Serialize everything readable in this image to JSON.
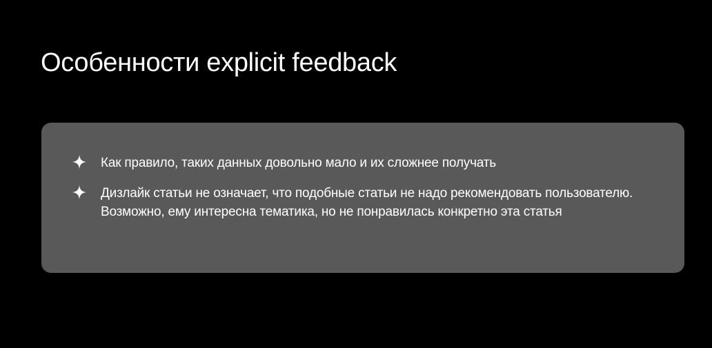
{
  "slide": {
    "title": "Особенности explicit feedback",
    "bullet_icon": "sparkle-icon",
    "colors": {
      "background": "#000000",
      "card": "#595959",
      "text": "#ffffff"
    },
    "bullets": [
      {
        "text": "Как правило, таких данных довольно мало и их сложнее получать"
      },
      {
        "text": "Дизлайк статьи не означает, что подобные статьи не надо рекомендовать пользователю. Возможно, ему интересна тематика, но не понравилась конкретно эта статья"
      }
    ]
  }
}
